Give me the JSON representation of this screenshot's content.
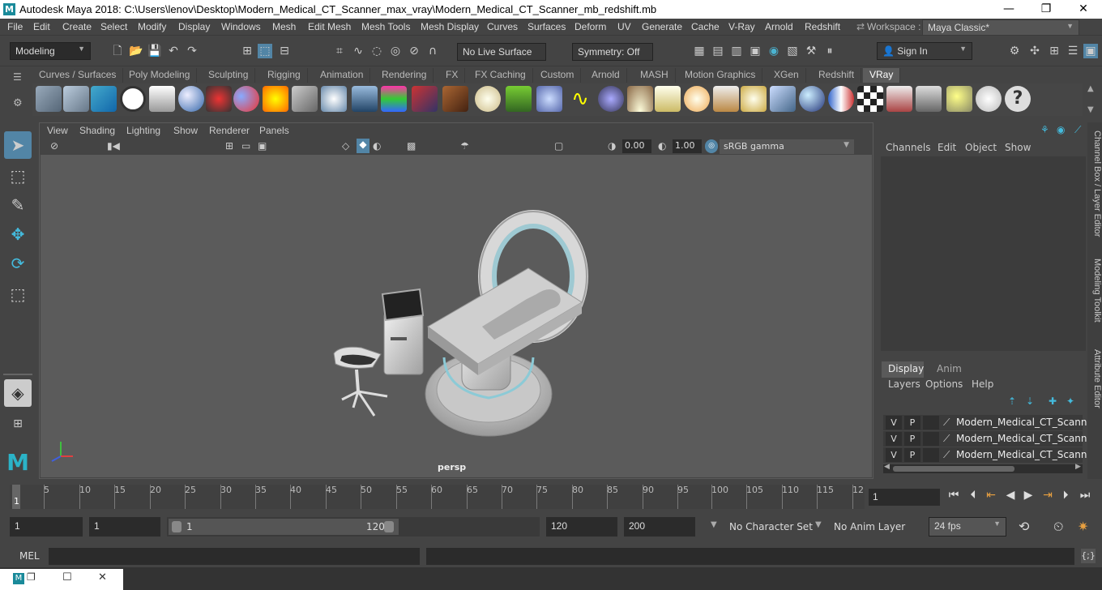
{
  "window": {
    "title": "Autodesk Maya 2018: C:\\Users\\lenov\\Desktop\\Modern_Medical_CT_Scanner_max_vray\\Modern_Medical_CT_Scanner_mb_redshift.mb",
    "minimize": "—",
    "maximize": "❐",
    "close": "✕"
  },
  "menu": [
    "File",
    "Edit",
    "Create",
    "Select",
    "Modify",
    "Display",
    "Windows",
    "Mesh",
    "Edit Mesh",
    "Mesh Tools",
    "Mesh Display",
    "Curves",
    "Surfaces",
    "Deform",
    "UV",
    "Generate",
    "Cache",
    "V-Ray",
    "Arnold",
    "Redshift"
  ],
  "workspace": {
    "label": "Workspace :",
    "value": "Maya Classic*"
  },
  "statusline": {
    "mode": "Modeling",
    "live_surface": "No Live Surface",
    "symmetry": "Symmetry: Off",
    "sign_in": "Sign In"
  },
  "shelf_tabs": [
    {
      "label": "Curves / Surfaces"
    },
    {
      "label": "Poly Modeling"
    },
    {
      "label": "Sculpting"
    },
    {
      "label": "Rigging"
    },
    {
      "label": "Animation"
    },
    {
      "label": "Rendering"
    },
    {
      "label": "FX"
    },
    {
      "label": "FX Caching"
    },
    {
      "label": "Custom"
    },
    {
      "label": "Arnold"
    },
    {
      "label": "MASH"
    },
    {
      "label": "Motion Graphics"
    },
    {
      "label": "XGen"
    },
    {
      "label": "Redshift"
    },
    {
      "label": "VRay"
    }
  ],
  "viewport": {
    "menu": [
      "View",
      "Shading",
      "Lighting",
      "Show",
      "Renderer",
      "Panels"
    ],
    "exposure": "0.00",
    "gamma": "1.00",
    "color_space": "sRGB gamma",
    "camera_label": "persp"
  },
  "channel_box": {
    "menu": [
      "Channels",
      "Edit",
      "Object",
      "Show"
    ]
  },
  "layer_editor": {
    "tabs": [
      "Display",
      "Anim"
    ],
    "menu": [
      "Layers",
      "Options",
      "Help"
    ],
    "layers": [
      {
        "v": "V",
        "p": "P",
        "name": "Modern_Medical_CT_Scanner_"
      },
      {
        "v": "V",
        "p": "P",
        "name": "Modern_Medical_CT_Scanner_"
      },
      {
        "v": "V",
        "p": "P",
        "name": "Modern_Medical_CT_Scanner_"
      }
    ]
  },
  "side_tabs": [
    "Channel Box / Layer Editor",
    "Modeling Toolkit",
    "Attribute Editor"
  ],
  "timeline": {
    "labels": [
      "1",
      "5",
      "10",
      "15",
      "20",
      "25",
      "30",
      "35",
      "40",
      "45",
      "50",
      "55",
      "60",
      "65",
      "70",
      "75",
      "80",
      "85",
      "90",
      "95",
      "100",
      "105",
      "110",
      "115",
      "12"
    ],
    "current_frame": "1"
  },
  "range": {
    "start": "1",
    "playback_start": "1",
    "slider_start": "1",
    "slider_end": "120",
    "playback_end": "120",
    "end": "200",
    "character_set": "No Character Set",
    "anim_layer": "No Anim Layer",
    "fps": "24 fps"
  },
  "cmdline": {
    "label": "MEL"
  },
  "colors": {
    "accent": "#5285a6",
    "viewport_bg": "#5b5b5b",
    "panel": "#444444"
  }
}
